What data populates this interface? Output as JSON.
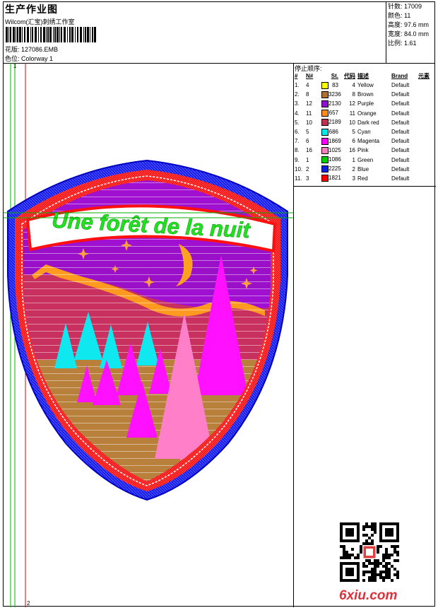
{
  "header": {
    "title": "生产作业图",
    "subtitle": "Wilcom(汇宝)刺绣工作室",
    "design_label": "花版: 127086.EMB",
    "colorway_label": "色位: Colorway 1"
  },
  "stats": [
    {
      "text": "针数: 17009"
    },
    {
      "text": "颜色: 11"
    },
    {
      "text": "高度: 97.6 mm"
    },
    {
      "text": "宽度: 84.0 mm"
    },
    {
      "text": "比例: 1.61"
    }
  ],
  "ruler": {
    "top": "1",
    "bottom": "2"
  },
  "patch": {
    "text": "Une forêt de la nuit"
  },
  "stop_table": {
    "title": "停止顺序:",
    "headers": [
      "#",
      "N#",
      "St.",
      "代码",
      "描述",
      "Brand",
      "元素"
    ],
    "rows": [
      {
        "idx": "1.",
        "n": "4",
        "color": "#ffff00",
        "st": "83",
        "code": "4",
        "desc": "Yellow",
        "brand": "Default"
      },
      {
        "idx": "2.",
        "n": "8",
        "color": "#b07030",
        "st": "3236",
        "code": "8",
        "desc": "Brown",
        "brand": "Default"
      },
      {
        "idx": "3.",
        "n": "12",
        "color": "#9010d0",
        "st": "2130",
        "code": "12",
        "desc": "Purple",
        "brand": "Default"
      },
      {
        "idx": "4.",
        "n": "11",
        "color": "#ff9020",
        "st": "657",
        "code": "11",
        "desc": "Orange",
        "brand": "Default"
      },
      {
        "idx": "5.",
        "n": "10",
        "color": "#c03050",
        "st": "2189",
        "code": "10",
        "desc": "Dark red",
        "brand": "Default"
      },
      {
        "idx": "6.",
        "n": "5",
        "color": "#00e8e8",
        "st": "686",
        "code": "5",
        "desc": "Cyan",
        "brand": "Default"
      },
      {
        "idx": "7.",
        "n": "6",
        "color": "#ff00ff",
        "st": "1869",
        "code": "6",
        "desc": "Magenta",
        "brand": "Default"
      },
      {
        "idx": "8.",
        "n": "16",
        "color": "#ff80c0",
        "st": "1025",
        "code": "16",
        "desc": "Pink",
        "brand": "Default"
      },
      {
        "idx": "9.",
        "n": "1",
        "color": "#00d000",
        "st": "1086",
        "code": "1",
        "desc": "Green",
        "brand": "Default"
      },
      {
        "idx": "10.",
        "n": "2",
        "color": "#1020e0",
        "st": "2225",
        "code": "2",
        "desc": "Blue",
        "brand": "Default"
      },
      {
        "idx": "11.",
        "n": "3",
        "color": "#ff0000",
        "st": "1821",
        "code": "3",
        "desc": "Red",
        "brand": "Default"
      }
    ]
  },
  "watermark": "6xiu.com",
  "icons": {
    "qr": "qr-code-icon",
    "barcode": "barcode-icon"
  }
}
